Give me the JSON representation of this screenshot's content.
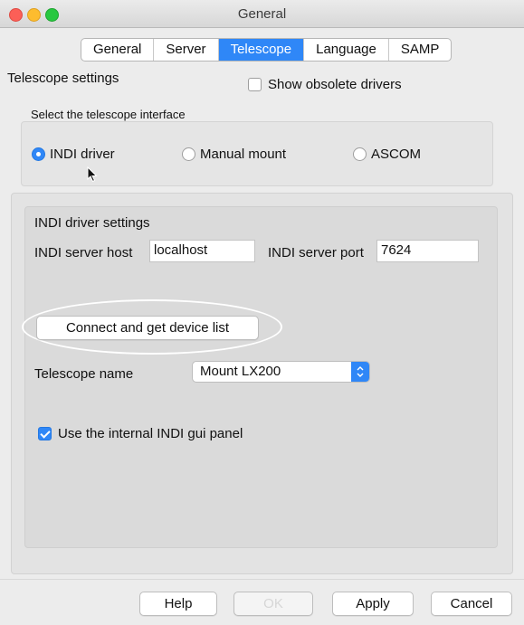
{
  "window": {
    "title": "General"
  },
  "tabs": [
    {
      "label": "General",
      "active": false
    },
    {
      "label": "Server",
      "active": false
    },
    {
      "label": "Telescope",
      "active": true
    },
    {
      "label": "Language",
      "active": false
    },
    {
      "label": "SAMP",
      "active": false
    }
  ],
  "telescope_settings": {
    "title": "Telescope settings",
    "show_obsolete": {
      "label": "Show obsolete drivers",
      "checked": false
    },
    "interface_label": "Select the telescope interface",
    "interfaces": [
      {
        "label": "INDI driver",
        "selected": true
      },
      {
        "label": "Manual mount",
        "selected": false
      },
      {
        "label": "ASCOM",
        "selected": false
      }
    ]
  },
  "indi_settings": {
    "title": "INDI driver settings",
    "host_label": "INDI server host",
    "host_value": "localhost",
    "port_label": "INDI server port",
    "port_value": "7624",
    "connect_button": "Connect and get device list",
    "telescope_name_label": "Telescope name",
    "telescope_name_value": "Mount LX200",
    "use_gui_panel": {
      "label": "Use the internal INDI gui panel",
      "checked": true
    }
  },
  "footer": {
    "help": "Help",
    "ok": "OK",
    "apply": "Apply",
    "cancel": "Cancel"
  },
  "colors": {
    "accent": "#2f87f7"
  }
}
